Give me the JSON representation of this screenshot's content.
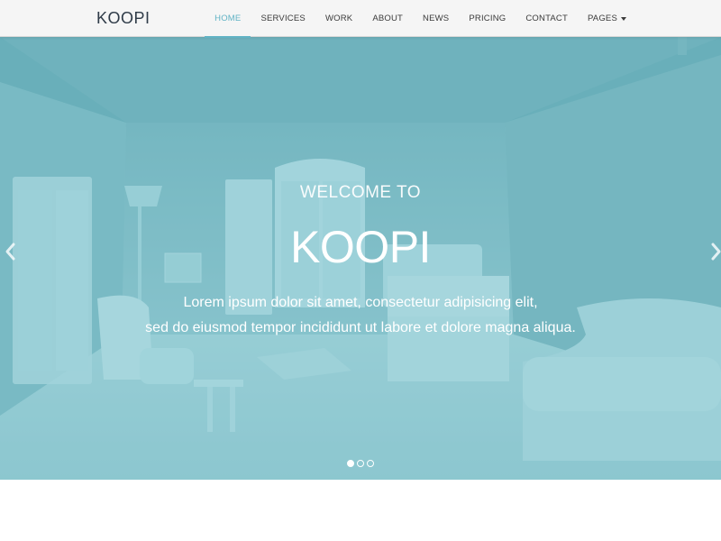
{
  "navbar": {
    "brand": "KOOPI",
    "items": [
      {
        "label": "HOME",
        "active": true
      },
      {
        "label": "SERVICES",
        "active": false
      },
      {
        "label": "WORK",
        "active": false
      },
      {
        "label": "ABOUT",
        "active": false
      },
      {
        "label": "NEWS",
        "active": false
      },
      {
        "label": "PRICING",
        "active": false
      },
      {
        "label": "CONTACT",
        "active": false
      },
      {
        "label": "PAGES",
        "active": false,
        "has_dropdown": true
      }
    ],
    "accent_color": "#61b3c5"
  },
  "hero": {
    "welcome": "WELCOME TO",
    "title": "KOOPI",
    "text_line1": "Lorem ipsum dolor sit amet, consectetur adipisicing elit,",
    "text_line2": "sed do eiusmod tempor incididunt ut labore et dolore magna aliqua.",
    "overlay_color": "#68b8c4",
    "left_arrow_icon": "chevron-left-icon",
    "right_arrow_icon": "chevron-right-icon",
    "slides_count": 3,
    "active_slide": 1
  }
}
